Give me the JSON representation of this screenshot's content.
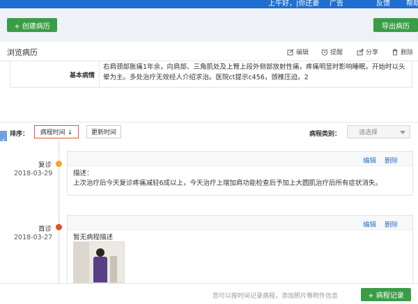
{
  "topbar": {
    "greeting": "上午好，|你还要",
    "menu": "广告",
    "feedback": "反馈",
    "help": "帮助"
  },
  "toolbar": {
    "create_label": "+ 创建病历",
    "export_label": "导出病历"
  },
  "header": {
    "title": "浏览病历",
    "actions": {
      "edit": "编辑",
      "remind": "提醒",
      "share": "分享",
      "delete": "删除"
    }
  },
  "info": {
    "label": "基本病情",
    "text": "右肩颈部胀痛1年余，向肩部、三角肌处及上臂上段外侧部放射性痛，疼痛明显时影响睡眠。开始时以头晕为主。多处治疗无效经人介绍求治。医院ct提示c456，颈椎压迫。2"
  },
  "sort": {
    "label": "排序：",
    "option1": "病程时间 ↓",
    "option2": "更新时间",
    "category_label": "病程类别：",
    "category_placeholder": "请选择"
  },
  "sidebar": {
    "toggle": "‹"
  },
  "timeline": [
    {
      "type": "复诊",
      "date": "2018-03-29",
      "dot_color": "#f5a623",
      "edit": "编辑",
      "delete": "删除",
      "desc_label": "描述：",
      "desc": "上次治疗后今天复诊疼痛减轻6成以上，今天治疗上增加肩功能检查后予加上大圆肌治疗后所有症状消失。"
    },
    {
      "type": "首诊",
      "date": "2018-03-27",
      "dot_color": "#e54b2c",
      "edit": "编辑",
      "delete": "删除",
      "desc": "暂无病程描述"
    }
  ],
  "footer": {
    "hint": "您可以按时间记录病程，添加照片等附件信息",
    "record_label": "+ 病程记录"
  },
  "colors": {
    "brand_green": "#3a9d46",
    "link_blue": "#2e73c9",
    "top_blue": "#1f6fd0"
  }
}
